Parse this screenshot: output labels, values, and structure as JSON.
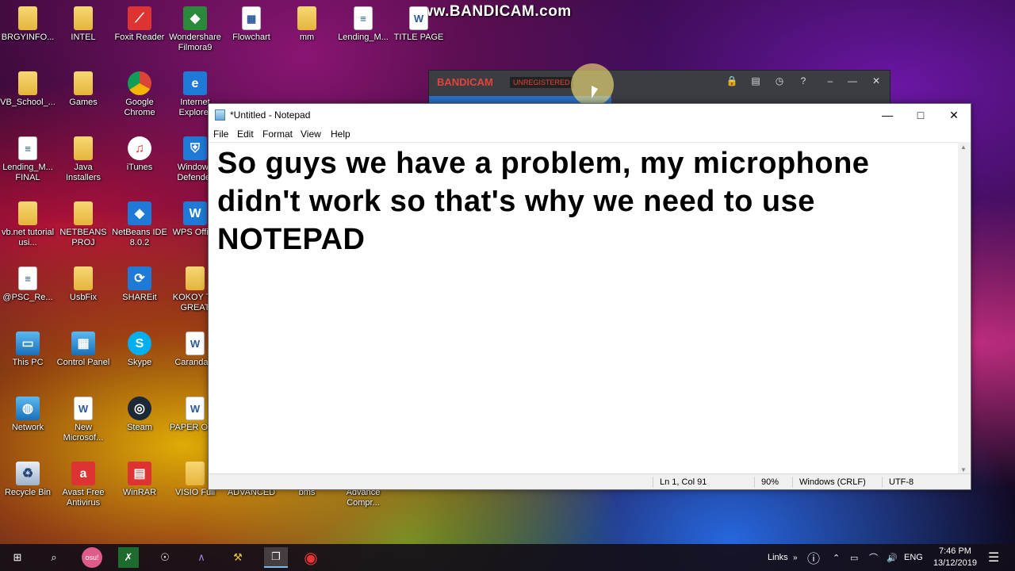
{
  "watermark": "www.BANDICAM.com",
  "desktop_icons": [
    {
      "label": "BRGYINFO...",
      "icon": "folder-icon"
    },
    {
      "label": "INTEL",
      "icon": "folder-icon"
    },
    {
      "label": "Foxit Reader",
      "icon": "foxit-icon"
    },
    {
      "label": "Wondershare Filmora9",
      "icon": "filmora-icon"
    },
    {
      "label": "Flowchart",
      "icon": "flowchart-icon"
    },
    {
      "label": "mm",
      "icon": "folder-icon"
    },
    {
      "label": "Lending_M...",
      "icon": "document-icon"
    },
    {
      "label": "TITLE PAGE",
      "icon": "word-icon"
    },
    {
      "label": "VB_School_...",
      "icon": "folder-icon"
    },
    {
      "label": "Games",
      "icon": "folder-icon"
    },
    {
      "label": "Google Chrome",
      "icon": "chrome-icon"
    },
    {
      "label": "Internet Explorer",
      "icon": "ie-icon"
    },
    {
      "label": "Lending_M... FINAL",
      "icon": "document-icon"
    },
    {
      "label": "Java Installers",
      "icon": "folder-icon"
    },
    {
      "label": "iTunes",
      "icon": "itunes-icon"
    },
    {
      "label": "Windows Defender",
      "icon": "shield-icon"
    },
    {
      "label": "vb.net tutorial usi...",
      "icon": "folder-icon"
    },
    {
      "label": "NETBEANS PROJ",
      "icon": "folder-icon"
    },
    {
      "label": "NetBeans IDE 8.0.2",
      "icon": "netbeans-icon"
    },
    {
      "label": "WPS Office",
      "icon": "wps-icon"
    },
    {
      "label": "@PSC_Re...",
      "icon": "document-icon"
    },
    {
      "label": "UsbFix",
      "icon": "folder-icon"
    },
    {
      "label": "SHAREit",
      "icon": "shareit-icon"
    },
    {
      "label": "KOKOY T... GREAT",
      "icon": "folder-icon"
    },
    {
      "label": "This PC",
      "icon": "computer-icon"
    },
    {
      "label": "Control Panel",
      "icon": "control-panel-icon"
    },
    {
      "label": "Skype",
      "icon": "skype-icon"
    },
    {
      "label": "Caranda...",
      "icon": "word-icon"
    },
    {
      "label": "Network",
      "icon": "network-icon"
    },
    {
      "label": "New Microsof...",
      "icon": "word-icon"
    },
    {
      "label": "Steam",
      "icon": "steam-icon"
    },
    {
      "label": "PAPER OOP",
      "icon": "word-icon"
    },
    {
      "label": "Recycle Bin",
      "icon": "recycle-bin-icon"
    },
    {
      "label": "Avast Free Antivirus",
      "icon": "avast-icon"
    },
    {
      "label": "WinRAR",
      "icon": "winrar-icon"
    },
    {
      "label": "VISIO Full",
      "icon": "folder-icon"
    },
    {
      "label": "ADVANCED",
      "icon": "folder-icon"
    },
    {
      "label": "bms",
      "icon": "folder-icon"
    },
    {
      "label": "Advance Compr...",
      "icon": "document-icon"
    }
  ],
  "bandicam": {
    "logo_a": "BANDI",
    "logo_b": "CAM",
    "badge": "UNREGISTERED",
    "buttons": [
      "lock-icon",
      "folder-icon",
      "clock-icon",
      "help-icon",
      "minimize-icon",
      "close-icon"
    ]
  },
  "notepad": {
    "title": "*Untitled - Notepad",
    "menu": [
      "File",
      "Edit",
      "Format",
      "View",
      "Help"
    ],
    "text": "So guys we have a problem, my microphone didn't work so that's why we need to use NOTEPAD",
    "status": {
      "position": "Ln 1, Col 91",
      "zoom": "90%",
      "line_endings": "Windows (CRLF)",
      "encoding": "UTF-8"
    }
  },
  "taskbar": {
    "links_label": "Links",
    "language": "ENG",
    "time": "7:46 PM",
    "date": "13/12/2019"
  }
}
